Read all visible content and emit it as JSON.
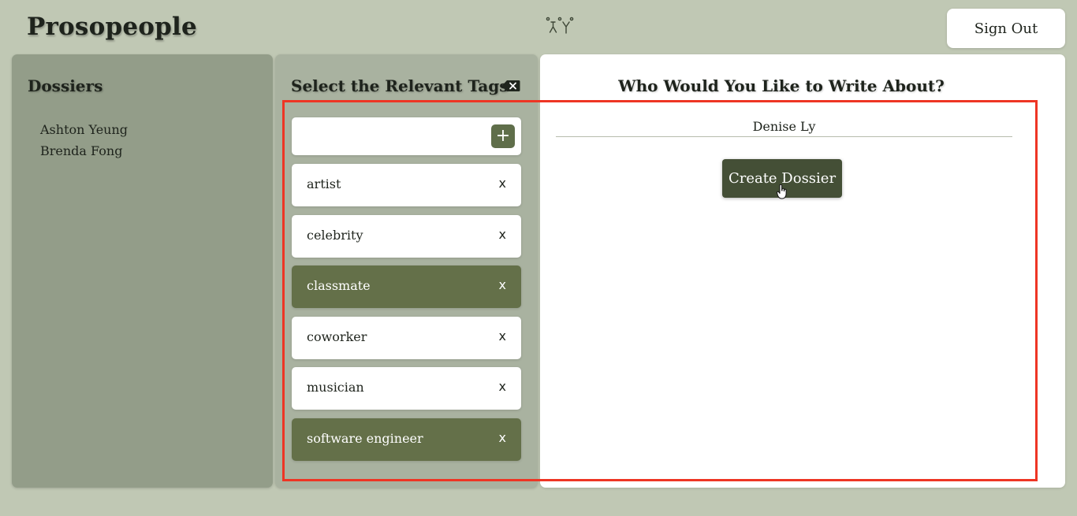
{
  "app": {
    "brand": "Prosopeople",
    "logo_icon": "people-logo-icon",
    "sign_out_label": "Sign Out"
  },
  "dossiers": {
    "title": "Dossiers",
    "items": [
      "Ashton Yeung",
      "Brenda Fong"
    ]
  },
  "tags": {
    "title": "Select the Relevant Tags",
    "clear_icon": "backspace-icon",
    "new_tag_value": "",
    "add_icon": "plus-icon",
    "remove_label": "x",
    "items": [
      {
        "label": "artist",
        "selected": false
      },
      {
        "label": "celebrity",
        "selected": false
      },
      {
        "label": "classmate",
        "selected": true
      },
      {
        "label": "coworker",
        "selected": false
      },
      {
        "label": "musician",
        "selected": false
      },
      {
        "label": "software engineer",
        "selected": true
      }
    ]
  },
  "write": {
    "title": "Who Would You Like to Write About?",
    "name_value": "Denise Ly",
    "create_label": "Create Dossier"
  },
  "colors": {
    "background": "#c0c8b4",
    "dossiers_panel": "#939d89",
    "tags_panel": "#a9b2a0",
    "selected_tag": "#647049",
    "primary_button": "#444f36",
    "highlight": "#ee3524"
  }
}
